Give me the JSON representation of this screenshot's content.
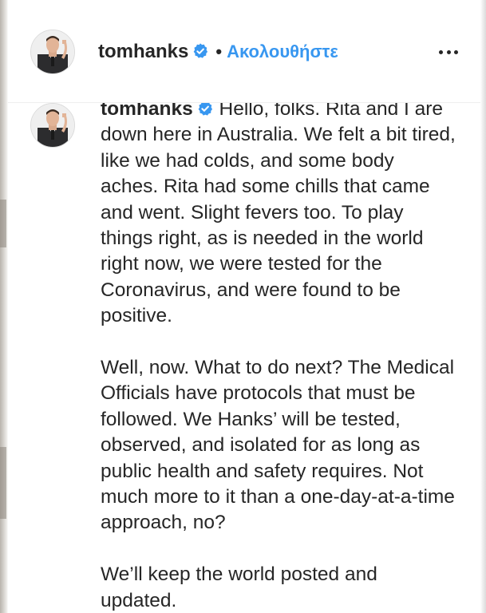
{
  "post": {
    "username": "tomhanks",
    "verified": true,
    "follow_label": "Ακολουθήστε",
    "separator": "•"
  },
  "caption": {
    "username": "tomhanks",
    "paragraphs": [
      "Hello, folks. Rita and I are down here in Australia. We felt a bit tired, like we had colds, and some body aches. Rita had some chills that came and went. Slight fevers too. To play things right, as is needed in the world right now, we were tested for the Coronavirus, and were found to be positive.",
      "Well, now. What to do next? The Medical Officials have protocols that must be followed. We Hanks’ will be tested, observed, and isolated for as long as public health and safety requires. Not much more to it than a one-day-at-a-time approach, no?",
      "We’ll keep the world posted and updated."
    ]
  },
  "colors": {
    "link": "#3897f0",
    "text": "#262626",
    "verified_badge": "#3897f0"
  },
  "icons": {
    "more": "more-options-icon",
    "verified": "verified-badge-icon"
  }
}
